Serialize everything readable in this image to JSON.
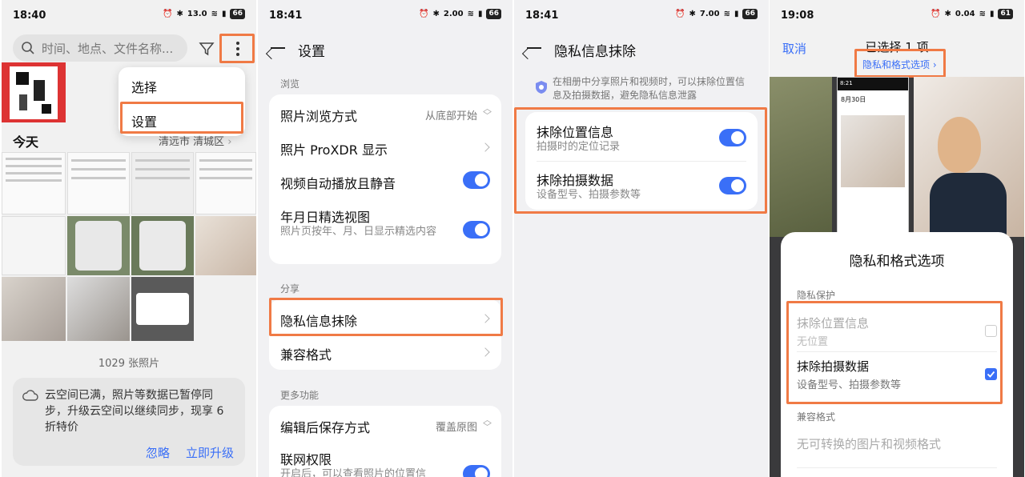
{
  "panel1": {
    "status": {
      "time": "18:40",
      "net": "13.0",
      "battery": "66"
    },
    "search_placeholder": "时间、地点、文件名称...",
    "menu": [
      "选择",
      "设置"
    ],
    "today_label": "今天",
    "location": "清远市 清城区",
    "photo_count": "1029 张照片",
    "cloud_notice": "云空间已满，照片等数据已暂停同步，升级云空间以继续同步，现享 6 折特价",
    "ignore_label": "忽略",
    "upgrade_label": "立即升级"
  },
  "panel2": {
    "status": {
      "time": "18:41",
      "net": "2.00",
      "battery": "66"
    },
    "title": "设置",
    "section_browse": "浏览",
    "browse_mode_label": "照片浏览方式",
    "browse_mode_value": "从底部开始",
    "proxdr_label": "照片 ProXDR 显示",
    "autoplay_label": "视频自动播放且静音",
    "featured_label": "年月日精选视图",
    "featured_sub": "照片页按年、月、日显示精选内容",
    "section_share": "分享",
    "privacy_erase_label": "隐私信息抹除",
    "compat_label": "兼容格式",
    "section_more": "更多功能",
    "save_mode_label": "编辑后保存方式",
    "save_mode_value": "覆盖原图",
    "network_label": "联网权限",
    "network_sub": "开启后，可以查看照片的位置信"
  },
  "panel3": {
    "status": {
      "time": "18:41",
      "net": "7.00",
      "battery": "66"
    },
    "title": "隐私信息抹除",
    "intro": "在相册中分享照片和视频时，可以抹除位置信息及拍摄数据，避免隐私信息泄露",
    "loc_title": "抹除位置信息",
    "loc_sub": "拍摄时的定位记录",
    "shot_title": "抹除拍摄数据",
    "shot_sub": "设备型号、拍摄参数等"
  },
  "panel4": {
    "status": {
      "time": "19:08",
      "net": "0.04",
      "battery": "61"
    },
    "cancel_label": "取消",
    "selected_label": "已选择 1 项",
    "options_link": "隐私和格式选项 ›",
    "preview_time": "8:21",
    "preview_date": "8月30日",
    "sheet_title": "隐私和格式选项",
    "section_privacy": "隐私保护",
    "loc_title": "抹除位置信息",
    "loc_sub": "无位置",
    "shot_title": "抹除拍摄数据",
    "shot_sub": "设备型号、拍摄参数等",
    "section_compat": "兼容格式",
    "compat_none": "无可转换的图片和视频格式"
  },
  "colors": {
    "accent": "#3a6ff7",
    "highlight": "#f07a45"
  }
}
